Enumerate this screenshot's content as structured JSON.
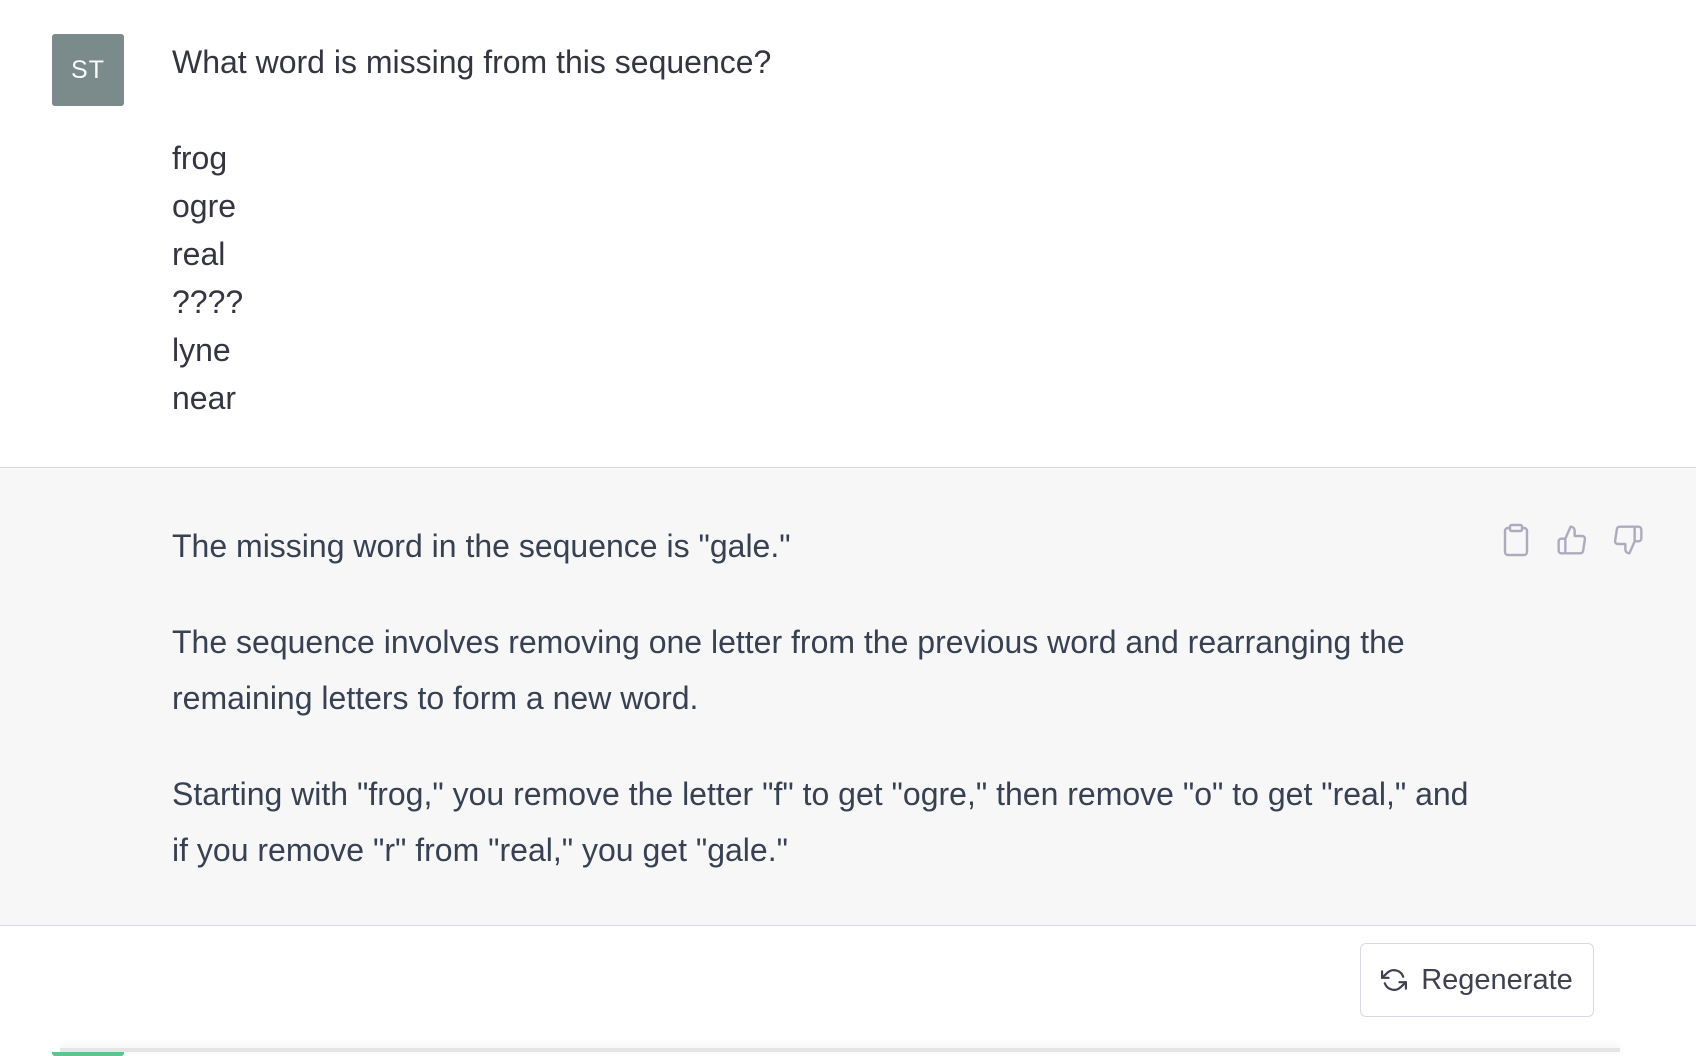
{
  "user_message": {
    "avatar_initials": "ST",
    "text": "What word is missing from this sequence?\n\nfrog\nogre\nreal\n????\nlyne\nnear"
  },
  "assistant_message": {
    "avatar_icon": "openai-logo-icon",
    "paragraphs": [
      "The missing word in the sequence is \"gale.\"",
      "The sequence involves removing one letter from the previous word and rearranging the remaining letters to form a new word.",
      "Starting with \"frog,\" you remove the letter \"f\" to get \"ogre,\" then remove \"o\" to get \"real,\" and if you remove \"r\" from \"real,\" you get \"gale.\""
    ],
    "actions": [
      "clipboard-icon",
      "thumbs-up-icon",
      "thumbs-down-icon"
    ]
  },
  "regenerate_button": {
    "label": "Regenerate",
    "icon": "refresh-icon"
  },
  "colors": {
    "user_avatar_bg": "#7b8a8b",
    "bot_avatar_bg": "#5fc590",
    "assistant_bg": "#f7f7f8",
    "text": "#343541"
  }
}
